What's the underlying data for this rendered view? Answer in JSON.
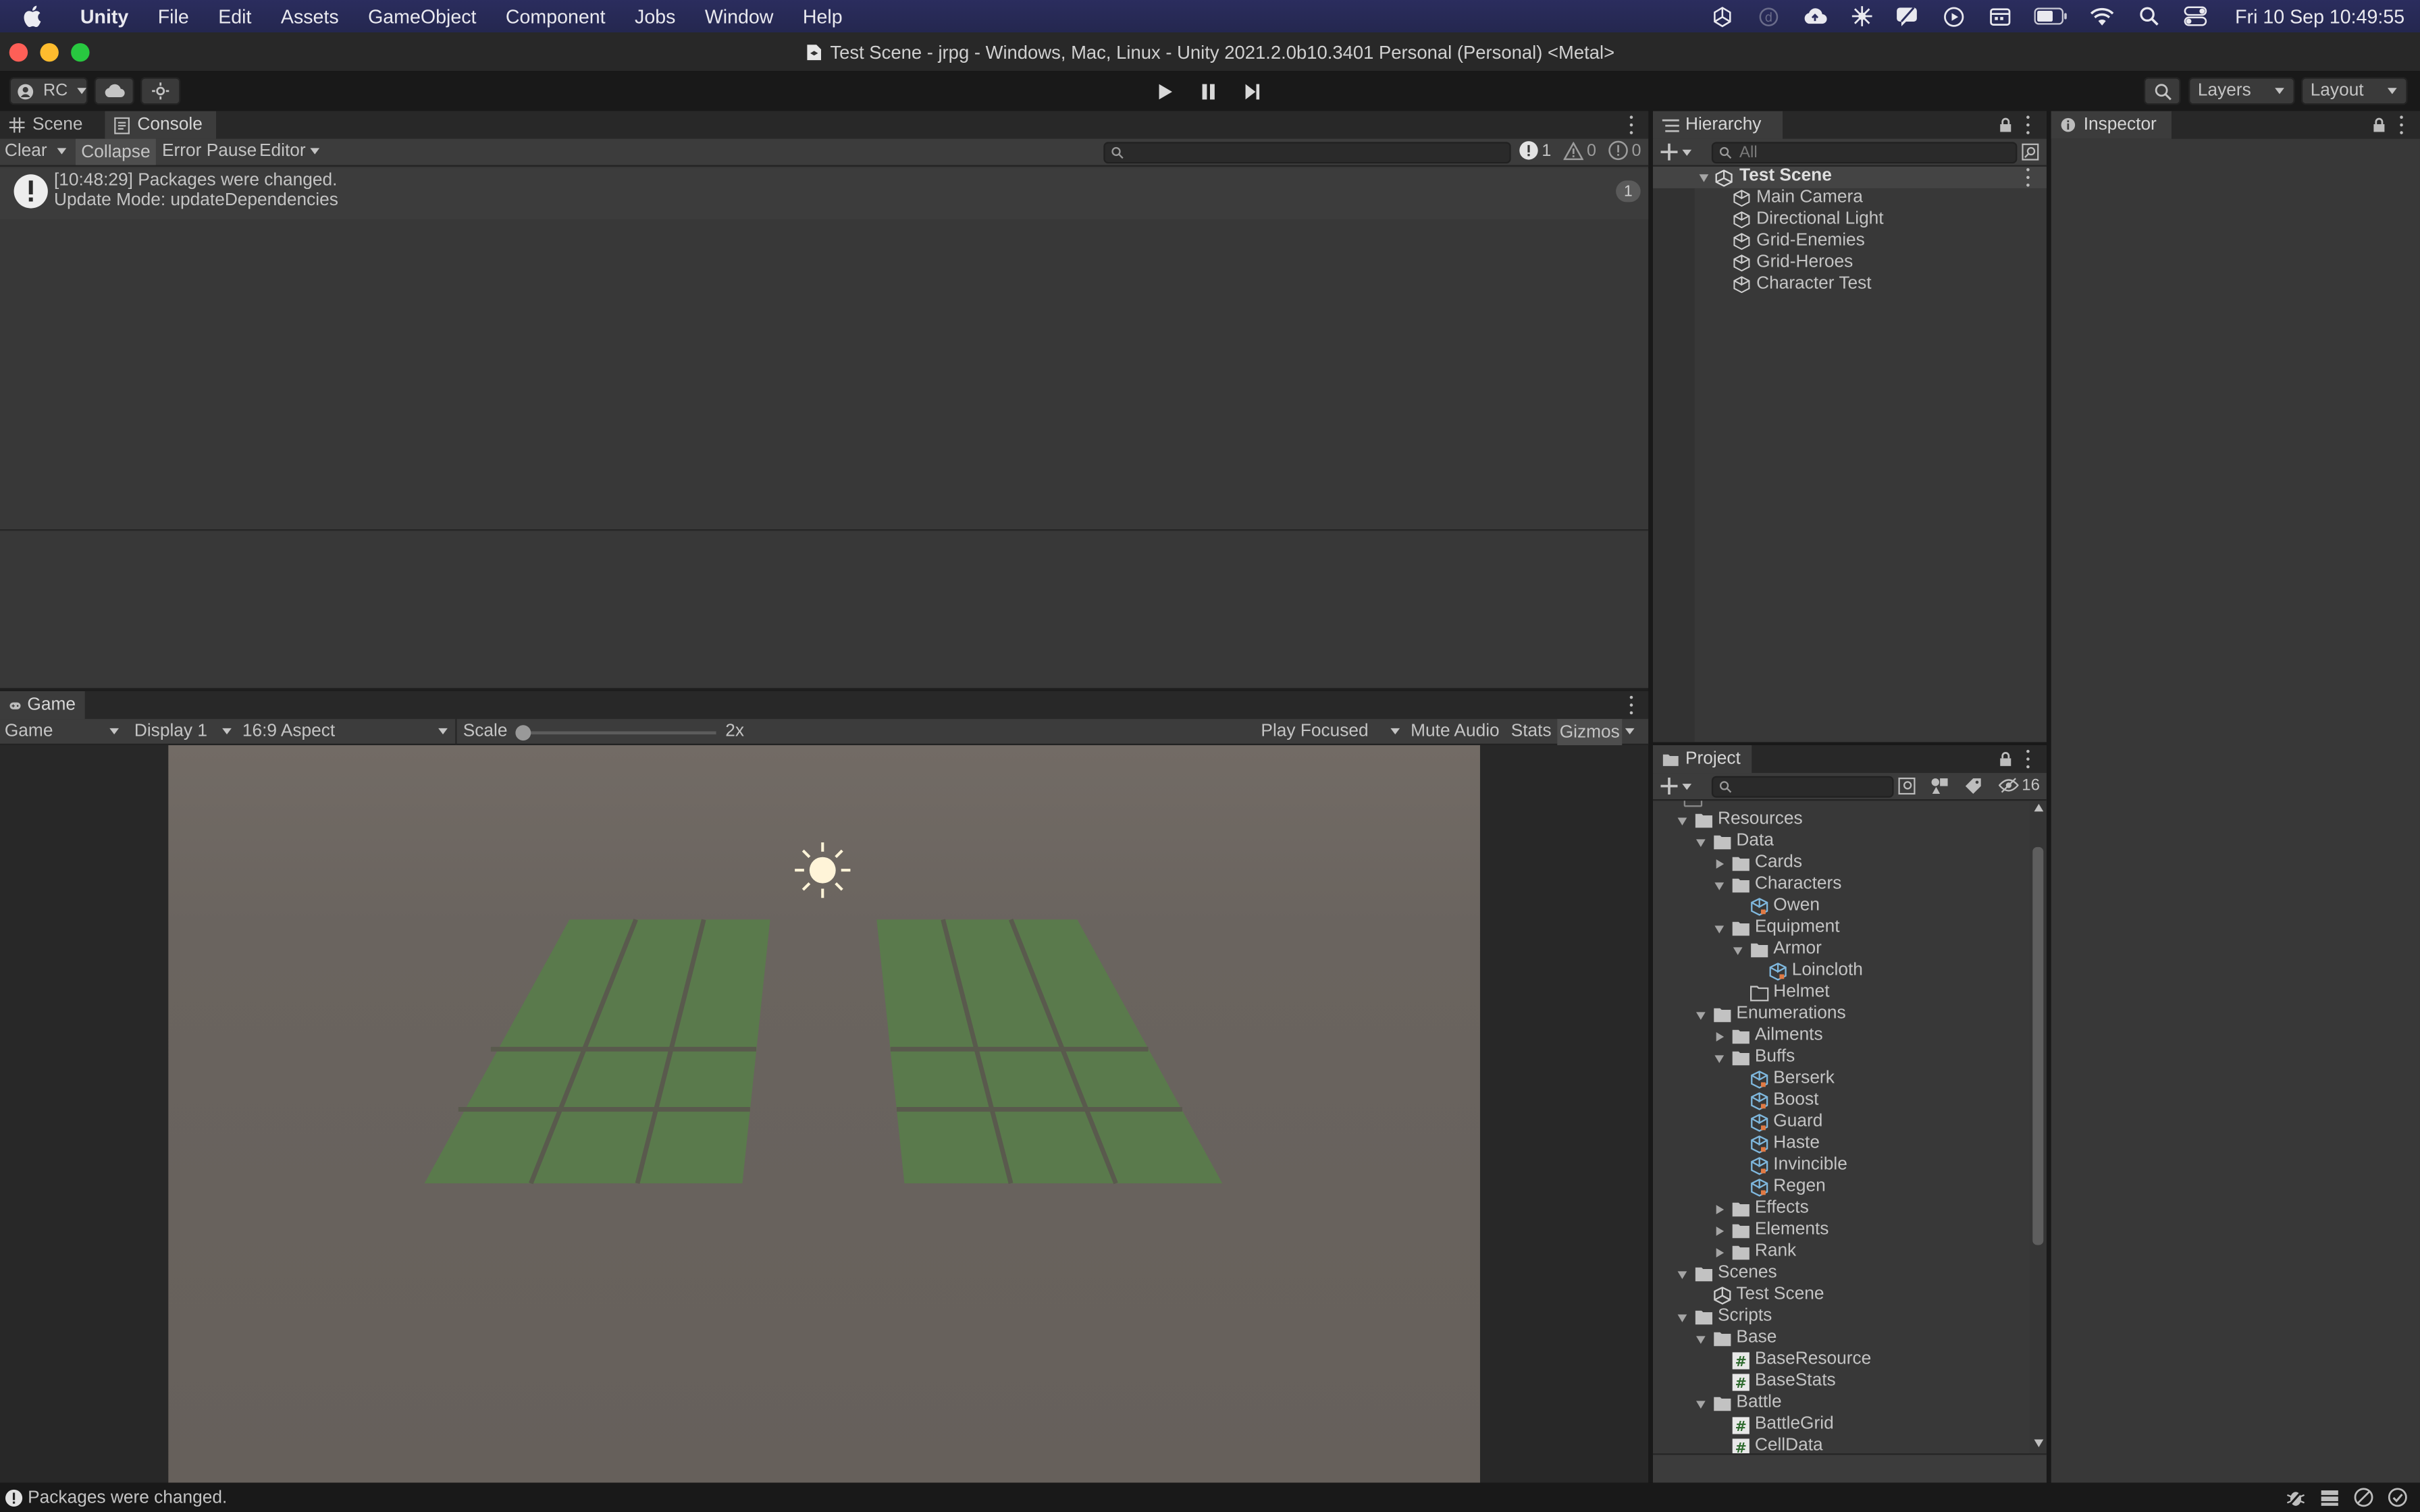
{
  "menubar": {
    "app": "Unity",
    "items": [
      "File",
      "Edit",
      "Assets",
      "GameObject",
      "Component",
      "Jobs",
      "Window",
      "Help"
    ],
    "clock": "Fri 10 Sep  10:49:55"
  },
  "window": {
    "title": "Test Scene - jrpg - Windows, Mac, Linux - Unity 2021.2.0b10.3401 Personal (Personal) <Metal>"
  },
  "toolbar": {
    "account": "RC",
    "layers": "Layers",
    "layout": "Layout"
  },
  "console": {
    "tabs": [
      "Scene",
      "Console"
    ],
    "clear": "Clear",
    "collapse": "Collapse",
    "error_pause": "Error Pause",
    "editor": "Editor",
    "count_info": "1",
    "count_warn": "0",
    "count_error": "0",
    "message_line1": "[10:48:29] Packages were changed.",
    "message_line2": "Update Mode: updateDependencies",
    "message_count": "1"
  },
  "game": {
    "tab": "Game",
    "view": "Game",
    "display": "Display 1",
    "aspect": "16:9 Aspect",
    "scale_label": "Scale",
    "scale_value": "2x",
    "scale_level": 0.0,
    "play_focused": "Play Focused",
    "mute": "Mute Audio",
    "stats": "Stats",
    "gizmos": "Gizmos"
  },
  "hierarchy": {
    "tab": "Hierarchy",
    "search_placeholder": "All",
    "scene": "Test Scene",
    "objects": [
      "Main Camera",
      "Directional Light",
      "Grid-Enemies",
      "Grid-Heroes",
      "Character Test"
    ]
  },
  "inspector": {
    "tab": "Inspector"
  },
  "project": {
    "tab": "Project",
    "hidden_count": "16",
    "rows": [
      {
        "label": "Resources",
        "depth": 0,
        "kind": "folder",
        "expand": "open"
      },
      {
        "label": "Data",
        "depth": 1,
        "kind": "folder",
        "expand": "open"
      },
      {
        "label": "Cards",
        "depth": 2,
        "kind": "folder",
        "expand": "closed"
      },
      {
        "label": "Characters",
        "depth": 2,
        "kind": "folder",
        "expand": "open"
      },
      {
        "label": "Owen",
        "depth": 3,
        "kind": "asset",
        "expand": "none"
      },
      {
        "label": "Equipment",
        "depth": 2,
        "kind": "folder",
        "expand": "open"
      },
      {
        "label": "Armor",
        "depth": 3,
        "kind": "folder",
        "expand": "open"
      },
      {
        "label": "Loincloth",
        "depth": 4,
        "kind": "asset",
        "expand": "none"
      },
      {
        "label": "Helmet",
        "depth": 3,
        "kind": "folder-empty",
        "expand": "none"
      },
      {
        "label": "Enumerations",
        "depth": 1,
        "kind": "folder",
        "expand": "open"
      },
      {
        "label": "Ailments",
        "depth": 2,
        "kind": "folder",
        "expand": "closed"
      },
      {
        "label": "Buffs",
        "depth": 2,
        "kind": "folder",
        "expand": "open"
      },
      {
        "label": "Berserk",
        "depth": 3,
        "kind": "asset",
        "expand": "none"
      },
      {
        "label": "Boost",
        "depth": 3,
        "kind": "asset",
        "expand": "none"
      },
      {
        "label": "Guard",
        "depth": 3,
        "kind": "asset",
        "expand": "none"
      },
      {
        "label": "Haste",
        "depth": 3,
        "kind": "asset",
        "expand": "none"
      },
      {
        "label": "Invincible",
        "depth": 3,
        "kind": "asset",
        "expand": "none"
      },
      {
        "label": "Regen",
        "depth": 3,
        "kind": "asset",
        "expand": "none"
      },
      {
        "label": "Effects",
        "depth": 2,
        "kind": "folder",
        "expand": "closed"
      },
      {
        "label": "Elements",
        "depth": 2,
        "kind": "folder",
        "expand": "closed"
      },
      {
        "label": "Rank",
        "depth": 2,
        "kind": "folder",
        "expand": "closed"
      },
      {
        "label": "Scenes",
        "depth": 0,
        "kind": "folder",
        "expand": "open"
      },
      {
        "label": "Test Scene",
        "depth": 1,
        "kind": "scene",
        "expand": "none"
      },
      {
        "label": "Scripts",
        "depth": 0,
        "kind": "folder",
        "expand": "open"
      },
      {
        "label": "Base",
        "depth": 1,
        "kind": "folder",
        "expand": "open"
      },
      {
        "label": "BaseResource",
        "depth": 2,
        "kind": "script",
        "expand": "none"
      },
      {
        "label": "BaseStats",
        "depth": 2,
        "kind": "script",
        "expand": "none"
      },
      {
        "label": "Battle",
        "depth": 1,
        "kind": "folder",
        "expand": "open"
      },
      {
        "label": "BattleGrid",
        "depth": 2,
        "kind": "script",
        "expand": "none"
      },
      {
        "label": "CellData",
        "depth": 2,
        "kind": "script",
        "expand": "none"
      }
    ]
  },
  "statusbar": {
    "message": "Packages were changed."
  },
  "colors": {
    "grid": "#5a7a4c",
    "grid_lines": "#4a5a40",
    "game_bg": "#6a645f",
    "editor_bg": "#383838"
  }
}
